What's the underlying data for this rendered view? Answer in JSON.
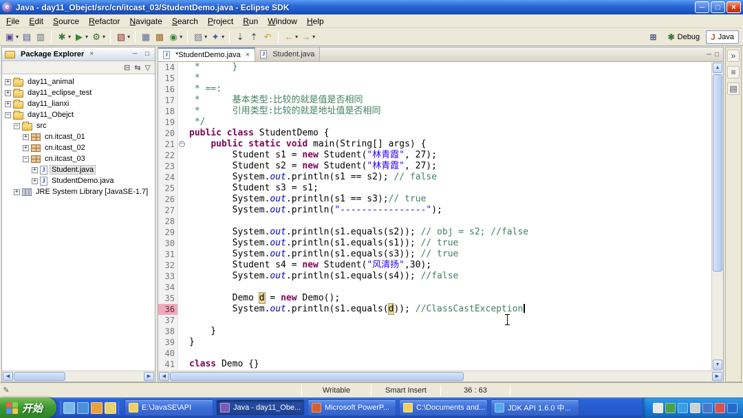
{
  "window": {
    "title": "Java - day11_Obejct/src/cn/itcast_03/StudentDemo.java - Eclipse SDK"
  },
  "menubar": [
    "File",
    "Edit",
    "Source",
    "Refactor",
    "Navigate",
    "Search",
    "Project",
    "Run",
    "Window",
    "Help"
  ],
  "toolbar": {
    "groups": [
      {
        "icons": [
          {
            "name": "new-wizard",
            "glyph": "▣",
            "color": "#5A4A9A",
            "dropdown": true
          },
          {
            "name": "save",
            "glyph": "▤",
            "color": "#4A5A9A"
          },
          {
            "name": "print",
            "glyph": "▥",
            "color": "#607080"
          }
        ]
      },
      {
        "icons": [
          {
            "name": "debug",
            "glyph": "✱",
            "color": "#3A7D3A",
            "dropdown": true
          },
          {
            "name": "run",
            "glyph": "▶",
            "color": "#2E8B2E",
            "dropdown": true
          },
          {
            "name": "external-tools",
            "glyph": "⚙",
            "color": "#2E6B2E",
            "dropdown": true
          }
        ]
      },
      {
        "icons": [
          {
            "name": "coverage",
            "glyph": "▧",
            "color": "#8A2A2A",
            "dropdown": true
          }
        ]
      },
      {
        "icons": [
          {
            "name": "new-java-project",
            "glyph": "▦",
            "color": "#5A6A9A"
          },
          {
            "name": "new-package",
            "glyph": "▩",
            "color": "#9A6A2A"
          },
          {
            "name": "new-class",
            "glyph": "◉",
            "color": "#2E8B2E",
            "dropdown": true
          }
        ]
      },
      {
        "icons": [
          {
            "name": "open-task",
            "glyph": "▨",
            "color": "#7A7A9A",
            "dropdown": true
          },
          {
            "name": "search",
            "glyph": "✦",
            "color": "#3A5A9A",
            "dropdown": true
          }
        ]
      },
      {
        "icons": [
          {
            "name": "next-annotation",
            "glyph": "⇣",
            "color": "#444444"
          },
          {
            "name": "previous-annotation",
            "glyph": "⇡",
            "color": "#444444"
          },
          {
            "name": "last-edit-location",
            "glyph": "↶",
            "color": "#B8A020"
          }
        ]
      },
      {
        "icons": [
          {
            "name": "back",
            "glyph": "←",
            "color": "#B8A020",
            "dropdown": true
          },
          {
            "name": "forward",
            "glyph": "→",
            "color": "#9A9A6A",
            "dropdown": true
          }
        ]
      }
    ]
  },
  "perspectives": {
    "items": [
      {
        "name": "open-perspective",
        "glyph": "⊞",
        "color": "#4A5A8A",
        "label": ""
      },
      {
        "name": "perspective-debug",
        "glyph": "✱",
        "color": "#3A7D3A",
        "label": "Debug"
      },
      {
        "name": "perspective-java",
        "glyph": "J",
        "color": "#C05A2A",
        "label": "Java",
        "active": true
      }
    ]
  },
  "package_explorer": {
    "title": "Package Explorer",
    "tree": [
      {
        "label": "day11_animal",
        "icon": "project",
        "depth": 0,
        "expander": "+"
      },
      {
        "label": "day11_eclipse_test",
        "icon": "project",
        "depth": 0,
        "expander": "+"
      },
      {
        "label": "day11_lianxi",
        "icon": "project",
        "depth": 0,
        "expander": "+"
      },
      {
        "label": "day11_Obejct",
        "icon": "project",
        "depth": 0,
        "expander": "-"
      },
      {
        "label": "src",
        "icon": "src",
        "depth": 1,
        "expander": "-"
      },
      {
        "label": "cn.itcast_01",
        "icon": "package",
        "depth": 2,
        "expander": "+"
      },
      {
        "label": "cn.itcast_02",
        "icon": "package",
        "depth": 2,
        "expander": "+"
      },
      {
        "label": "cn.itcast_03",
        "icon": "package",
        "depth": 2,
        "expander": "-"
      },
      {
        "label": "Student.java",
        "icon": "class",
        "depth": 3,
        "expander": "+",
        "selected": true
      },
      {
        "label": "StudentDemo.java",
        "icon": "class",
        "depth": 3,
        "expander": "+"
      },
      {
        "label": "JRE System Library [JavaSE-1.7]",
        "icon": "library",
        "depth": 1,
        "expander": "+"
      }
    ]
  },
  "editor": {
    "tabs": [
      {
        "label": "*StudentDemo.java",
        "active": true
      },
      {
        "label": "Student.java",
        "active": false
      }
    ],
    "lines": [
      {
        "n": 14,
        "t": [
          [
            "cmt",
            " *      }"
          ]
        ]
      },
      {
        "n": 15,
        "t": [
          [
            "cmt",
            " * "
          ]
        ]
      },
      {
        "n": 16,
        "t": [
          [
            "cmt",
            " * ==:"
          ]
        ]
      },
      {
        "n": 17,
        "t": [
          [
            "cmt",
            " *      基本类型:比较的就是值是否相同"
          ]
        ]
      },
      {
        "n": 18,
        "t": [
          [
            "cmt",
            " *      引用类型:比较的就是地址值是否相同"
          ]
        ]
      },
      {
        "n": 19,
        "t": [
          [
            "cmt",
            " */"
          ]
        ]
      },
      {
        "n": 20,
        "t": [
          [
            "kw",
            "public class"
          ],
          [
            "pln",
            " StudentDemo {"
          ]
        ]
      },
      {
        "n": 21,
        "fold": "open",
        "t": [
          [
            "pln",
            "    "
          ],
          [
            "kw",
            "public static void"
          ],
          [
            "pln",
            " main(String[] args) {"
          ]
        ]
      },
      {
        "n": 22,
        "t": [
          [
            "pln",
            "        Student s1 = "
          ],
          [
            "kw",
            "new"
          ],
          [
            "pln",
            " Student("
          ],
          [
            "str",
            "\"林青霞\""
          ],
          [
            "pln",
            ", 27);"
          ]
        ]
      },
      {
        "n": 23,
        "t": [
          [
            "pln",
            "        Student s2 = "
          ],
          [
            "kw",
            "new"
          ],
          [
            "pln",
            " Student("
          ],
          [
            "str",
            "\"林青霞\""
          ],
          [
            "pln",
            ", 27);"
          ]
        ]
      },
      {
        "n": 24,
        "t": [
          [
            "pln",
            "        System."
          ],
          [
            "fld",
            "out"
          ],
          [
            "pln",
            ".println(s1 == s2); "
          ],
          [
            "cmt",
            "// false"
          ]
        ]
      },
      {
        "n": 25,
        "t": [
          [
            "pln",
            "        Student s3 = s1;"
          ]
        ]
      },
      {
        "n": 26,
        "t": [
          [
            "pln",
            "        System."
          ],
          [
            "fld",
            "out"
          ],
          [
            "pln",
            ".println(s1 == s3);"
          ],
          [
            "cmt",
            "// true"
          ]
        ]
      },
      {
        "n": 27,
        "t": [
          [
            "pln",
            "        System."
          ],
          [
            "fld",
            "out"
          ],
          [
            "pln",
            ".println("
          ],
          [
            "str",
            "\"----------------\""
          ],
          [
            "pln",
            ");"
          ]
        ]
      },
      {
        "n": 28,
        "t": []
      },
      {
        "n": 29,
        "t": [
          [
            "pln",
            "        System."
          ],
          [
            "fld",
            "out"
          ],
          [
            "pln",
            ".println(s1.equals(s2)); "
          ],
          [
            "cmt",
            "// obj = s2; //false"
          ]
        ]
      },
      {
        "n": 30,
        "t": [
          [
            "pln",
            "        System."
          ],
          [
            "fld",
            "out"
          ],
          [
            "pln",
            ".println(s1.equals(s1)); "
          ],
          [
            "cmt",
            "// true"
          ]
        ]
      },
      {
        "n": 31,
        "t": [
          [
            "pln",
            "        System."
          ],
          [
            "fld",
            "out"
          ],
          [
            "pln",
            ".println(s1.equals(s3)); "
          ],
          [
            "cmt",
            "// true"
          ]
        ]
      },
      {
        "n": 32,
        "t": [
          [
            "pln",
            "        Student s4 = "
          ],
          [
            "kw",
            "new"
          ],
          [
            "pln",
            " Student("
          ],
          [
            "str",
            "\"风清扬\""
          ],
          [
            "pln",
            ",30);"
          ]
        ]
      },
      {
        "n": 33,
        "t": [
          [
            "pln",
            "        System."
          ],
          [
            "fld",
            "out"
          ],
          [
            "pln",
            ".println(s1.equals(s4)); "
          ],
          [
            "cmt",
            "//false"
          ]
        ]
      },
      {
        "n": 34,
        "t": []
      },
      {
        "n": 35,
        "t": [
          [
            "pln",
            "        Demo "
          ],
          [
            "hl",
            "d"
          ],
          [
            "pln",
            " = "
          ],
          [
            "kw",
            "new"
          ],
          [
            "pln",
            " Demo();"
          ]
        ]
      },
      {
        "n": 36,
        "cur": true,
        "caret": true,
        "t": [
          [
            "pln",
            "        System."
          ],
          [
            "fld",
            "out"
          ],
          [
            "pln",
            ".println(s1.equals("
          ],
          [
            "hl",
            "d"
          ],
          [
            "pln",
            ")); "
          ],
          [
            "cmt",
            "//ClassCastException"
          ]
        ]
      },
      {
        "n": 37,
        "t": []
      },
      {
        "n": 38,
        "t": [
          [
            "pln",
            "    }"
          ]
        ]
      },
      {
        "n": 39,
        "t": [
          [
            "pln",
            "}"
          ]
        ]
      },
      {
        "n": 40,
        "t": []
      },
      {
        "n": 41,
        "t": [
          [
            "kw",
            "class"
          ],
          [
            "pln",
            " Demo {}"
          ]
        ]
      }
    ]
  },
  "status_bar": {
    "writable": "Writable",
    "insert_mode": "Smart Insert",
    "position": "36 : 63"
  },
  "taskbar": {
    "start_label": "开始",
    "quick_launch": [
      {
        "name": "show-desktop",
        "color": "#79B8E8"
      },
      {
        "name": "internet-explorer",
        "color": "#4A90D8"
      },
      {
        "name": "media-player",
        "color": "#E8A23A"
      },
      {
        "name": "folder-launcher",
        "color": "#E8D06A"
      }
    ],
    "buttons": [
      {
        "name": "explorer-javase-api",
        "label": "E:\\JavaSE\\API",
        "icon_color": "#F0D060"
      },
      {
        "name": "eclipse-task",
        "label": "Java - day11_Obe...",
        "icon_color": "#7A5AB8",
        "active": true
      },
      {
        "name": "powerpoint-task",
        "label": "Microsoft PowerP...",
        "icon_color": "#D86030"
      },
      {
        "name": "documents-task",
        "label": "C:\\Documents and...",
        "icon_color": "#F0D060"
      },
      {
        "name": "jdk-api-task",
        "label": "JDK API 1.6.0 中...",
        "icon_color": "#58A8E8"
      }
    ],
    "tray": [
      {
        "name": "ime-indicator",
        "color": "#E8E8E8"
      },
      {
        "name": "green-tray-icon",
        "color": "#48A048"
      },
      {
        "name": "messenger-tray-icon",
        "color": "#38A0E0"
      },
      {
        "name": "volume-tray-icon",
        "color": "#D0D0D0"
      },
      {
        "name": "network-tray-icon",
        "color": "#4878C8"
      },
      {
        "name": "red-tray-icon",
        "color": "#D85050"
      },
      {
        "name": "blue-tray-icon",
        "color": "#2868C8"
      }
    ]
  }
}
